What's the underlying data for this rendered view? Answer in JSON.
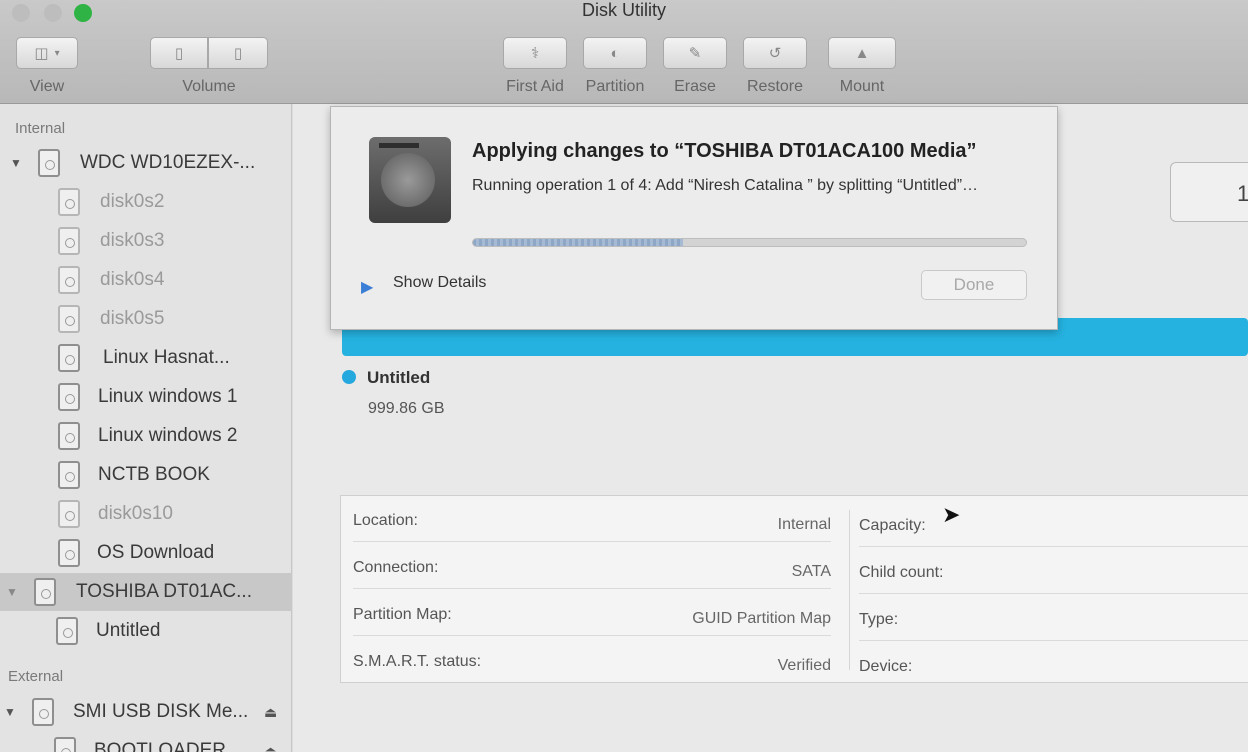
{
  "window": {
    "title": "Disk Utility"
  },
  "toolbar": {
    "view_label": "View",
    "volume_label": "Volume",
    "first_aid_label": "First Aid",
    "partition_label": "Partition",
    "erase_label": "Erase",
    "restore_label": "Restore",
    "mount_label": "Mount"
  },
  "sidebar": {
    "internal_header": "Internal",
    "external_header": "External",
    "items": [
      {
        "label": "WDC WD10EZEX-..."
      },
      {
        "label": "disk0s2"
      },
      {
        "label": "disk0s3"
      },
      {
        "label": "disk0s4"
      },
      {
        "label": "disk0s5"
      },
      {
        "label": "Linux Hasnat..."
      },
      {
        "label": "Linux windows 1"
      },
      {
        "label": "Linux windows 2"
      },
      {
        "label": "NCTB BOOK"
      },
      {
        "label": "disk0s10"
      },
      {
        "label": "OS Download"
      },
      {
        "label": "TOSHIBA DT01AC..."
      },
      {
        "label": "Untitled"
      },
      {
        "label": "SMI USB DISK Me..."
      },
      {
        "label": "BOOTLOADER"
      }
    ]
  },
  "dialog": {
    "title": "Applying changes to “TOSHIBA DT01ACA100 Media”",
    "message": "Running operation 1 of 4: Add “Niresh Catalina ” by splitting “Untitled”…",
    "progress": 0.38,
    "show_details_label": "Show Details",
    "done_label": "Done"
  },
  "partition": {
    "name": "Untitled",
    "size": "999.86 GB",
    "color": "#25a8dd",
    "field_partial": "1"
  },
  "info": {
    "location_label": "Location:",
    "location_value": "Internal",
    "connection_label": "Connection:",
    "connection_value": "SATA",
    "partition_map_label": "Partition Map:",
    "partition_map_value": "GUID Partition Map",
    "smart_label": "S.M.A.R.T. status:",
    "smart_value": "Verified",
    "capacity_label": "Capacity:",
    "child_count_label": "Child count:",
    "type_label": "Type:",
    "device_label": "Device:"
  }
}
